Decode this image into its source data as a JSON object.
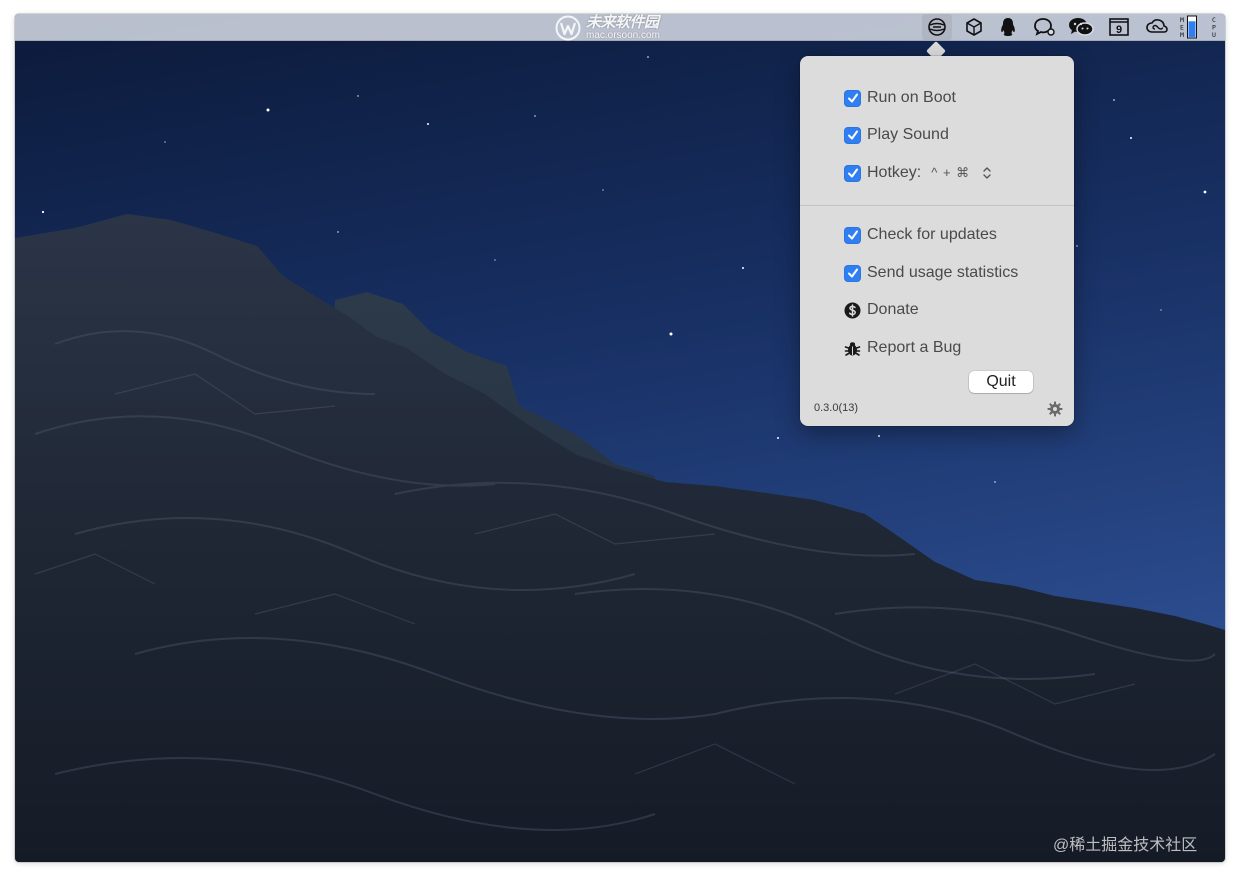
{
  "watermark_top": {
    "chinese": "未来软件园",
    "url": "mac.orsoon.com"
  },
  "menubar": {
    "status_icons": [
      "network-globe-icon",
      "package-box-icon",
      "qq-penguin-icon",
      "chat-bubble-icon",
      "wechat-icon",
      "calendar-icon",
      "creative-cloud-icon",
      "mem-meter-icon",
      "cpu-meter-icon"
    ],
    "calendar_day": "9",
    "mem_label": "MEM",
    "cpu_label": "CPU",
    "mem_level": 0.75
  },
  "popover": {
    "items": [
      {
        "label": "Run on Boot",
        "checked": true
      },
      {
        "label": "Play Sound",
        "checked": true
      },
      {
        "label": "Hotkey:",
        "checked": true,
        "keys": "^ + ⌘"
      },
      {
        "label": "Check for updates",
        "checked": true
      },
      {
        "label": "Send usage statistics",
        "checked": true
      },
      {
        "label": "Donate",
        "icon": "dollar-circle-icon"
      },
      {
        "label": "Report a Bug",
        "icon": "bug-icon"
      }
    ],
    "quit_label": "Quit",
    "version": "0.3.0(13)"
  },
  "colors": {
    "accent": "#2f7ff2",
    "sky_top": "#0d1c3d",
    "sky_bottom": "#2c4c8f"
  },
  "watermark_bottom": "@稀土掘金技术社区"
}
